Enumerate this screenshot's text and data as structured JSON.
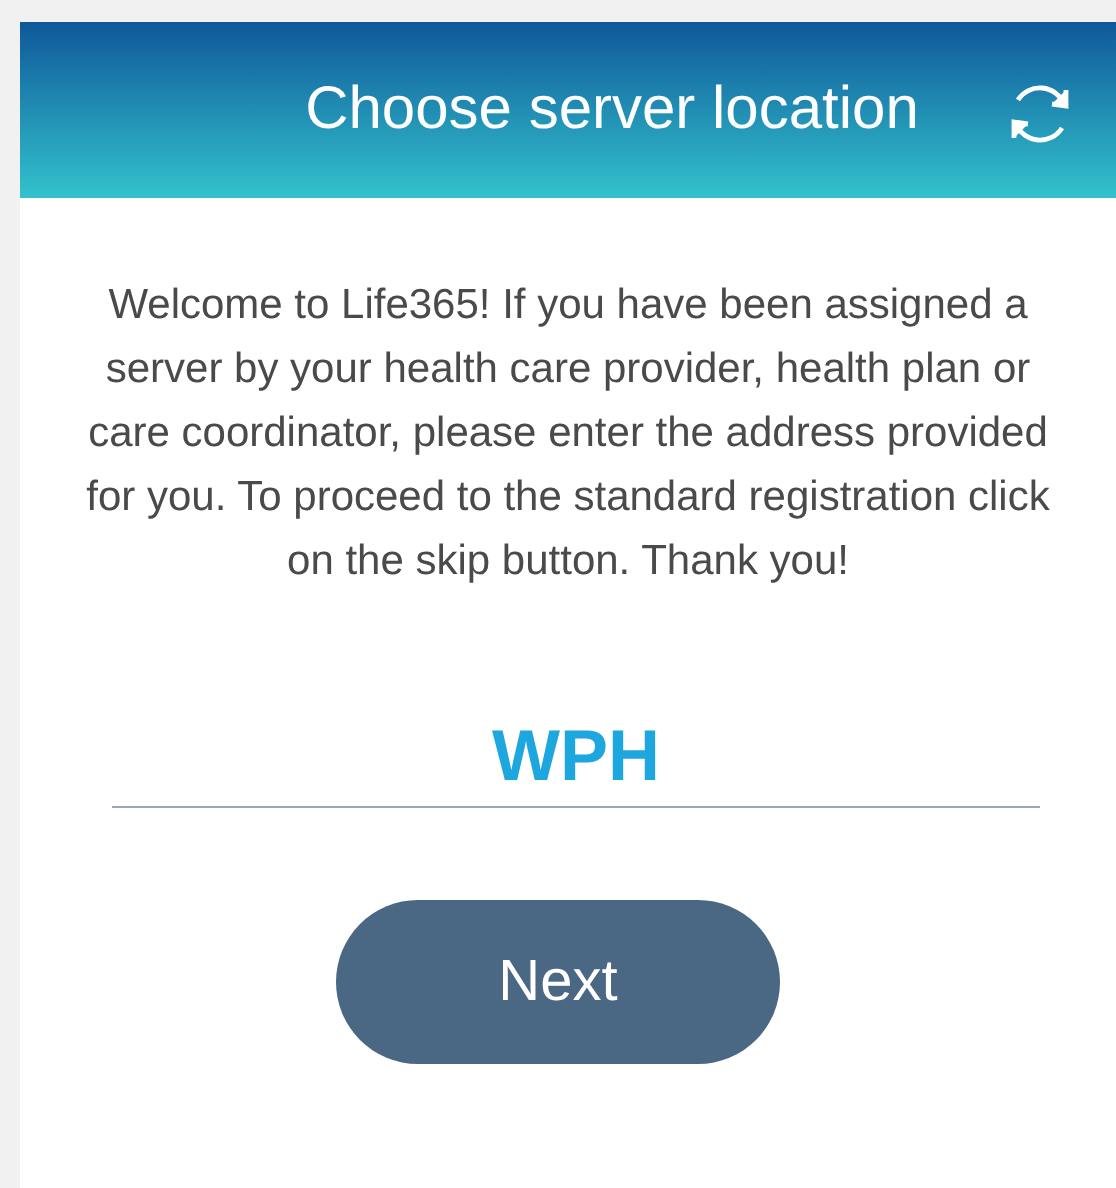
{
  "header": {
    "title": "Choose server location"
  },
  "intro": "Welcome to Life365! If you have been assigned a server by your health care provider, health plan or care coordinator, please enter the address provided for you. To proceed to the standard registration click on the skip button. Thank you!",
  "server_field": {
    "value": "WPH"
  },
  "buttons": [
    {
      "label": "Next"
    }
  ]
}
